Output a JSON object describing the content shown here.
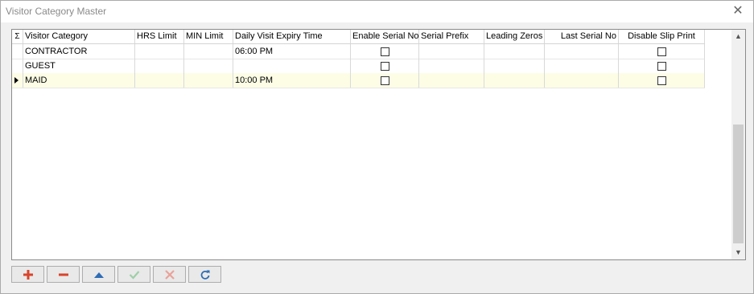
{
  "window": {
    "title": "Visitor Category Master"
  },
  "grid": {
    "indicator_header": "Σ",
    "columns": [
      "Visitor Category",
      "HRS Limit",
      "MIN Limit",
      "Daily Visit Expiry Time",
      "Enable Serial No",
      "Serial Prefix",
      "Leading Zeros",
      "Last Serial No",
      "Disable Slip Print"
    ],
    "rows": [
      {
        "category": "CONTRACTOR",
        "hrs": "",
        "min": "",
        "expiry": "06:00 PM",
        "enable_serial": false,
        "prefix": "",
        "zeros": "",
        "last_serial": "",
        "disable_slip": false
      },
      {
        "category": "GUEST",
        "hrs": "",
        "min": "",
        "expiry": "",
        "enable_serial": false,
        "prefix": "",
        "zeros": "",
        "last_serial": "",
        "disable_slip": false
      },
      {
        "category": "MAID",
        "hrs": "",
        "min": "",
        "expiry": "10:00 PM",
        "enable_serial": false,
        "prefix": "",
        "zeros": "",
        "last_serial": "",
        "disable_slip": false,
        "current": true
      }
    ]
  },
  "toolbar": {
    "buttons": [
      {
        "name": "add-button",
        "icon": "plus-icon",
        "color": "#d9442b"
      },
      {
        "name": "delete-button",
        "icon": "minus-icon",
        "color": "#d9442b"
      },
      {
        "name": "move-up-button",
        "icon": "triangle-up-icon",
        "color": "#2f6db5"
      },
      {
        "name": "save-button",
        "icon": "check-icon",
        "color": "#9fcfa8"
      },
      {
        "name": "cancel-button",
        "icon": "x-icon",
        "color": "#e8a39a"
      },
      {
        "name": "refresh-button",
        "icon": "refresh-icon",
        "color": "#2f6db5"
      }
    ]
  }
}
